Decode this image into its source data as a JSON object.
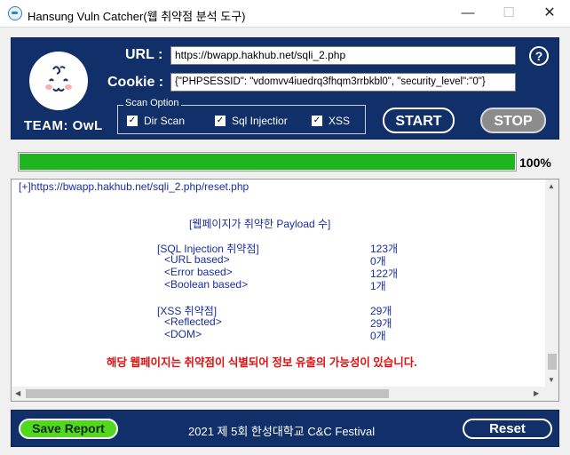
{
  "window": {
    "title": "Hansung Vuln Catcher(웹 취약점 분석 도구)",
    "minimize_glyph": "—",
    "maximize_glyph": "☐",
    "close_glyph": "✕"
  },
  "form": {
    "url_label": "URL :",
    "url_value": "https://bwapp.hakhub.net/sqli_2.php",
    "cookie_label": "Cookie :",
    "cookie_value": "{\"PHPSESSID\": \"vdomvv4iuedrq3fhqm3rrbkbl0\", \"security_level\":\"0\"}",
    "help_glyph": "?"
  },
  "logo": {
    "team_label": "TEAM: OwL"
  },
  "scan_option": {
    "legend": "Scan Option",
    "options": [
      {
        "label": "Dir Scan",
        "checked": true
      },
      {
        "label": "Sql Injectior",
        "checked": true
      },
      {
        "label": "XSS",
        "checked": true
      }
    ],
    "check_glyph": "✓"
  },
  "actions": {
    "start_label": "START",
    "stop_label": "STOP"
  },
  "progress": {
    "value": 1.0,
    "label": "100%"
  },
  "result": {
    "url_line": "[+]https://bwapp.hakhub.net/sqli_2.php/reset.php",
    "title": "[웹페이지가 취약한 Payload 수]",
    "rows": [
      {
        "label": "[SQL Injection 취약점]",
        "count": "123개"
      },
      {
        "label": "<URL based>",
        "count": "0개"
      },
      {
        "label": "<Error based>",
        "count": "122개"
      },
      {
        "label": "<Boolean based>",
        "count": "1개"
      },
      {
        "label": "[XSS 취약점]",
        "count": "29개"
      },
      {
        "label": "<Reflected>",
        "count": "29개"
      },
      {
        "label": "<DOM>",
        "count": "0개"
      }
    ],
    "warning": "해당 웹페이지는 취약점이 식별되어 정보 유출의 가능성이 있습니다."
  },
  "footer": {
    "save_label": "Save Report",
    "text": "2021 제 5회 한성대학교 C&C Festival",
    "reset_label": "Reset"
  },
  "colors": {
    "panel": "#11306a",
    "progress": "#1fb51f",
    "save_button": "#52d91d",
    "warning": "#e01010",
    "result_text": "#1a2ea0",
    "stop_button": "#8c8c8c"
  }
}
